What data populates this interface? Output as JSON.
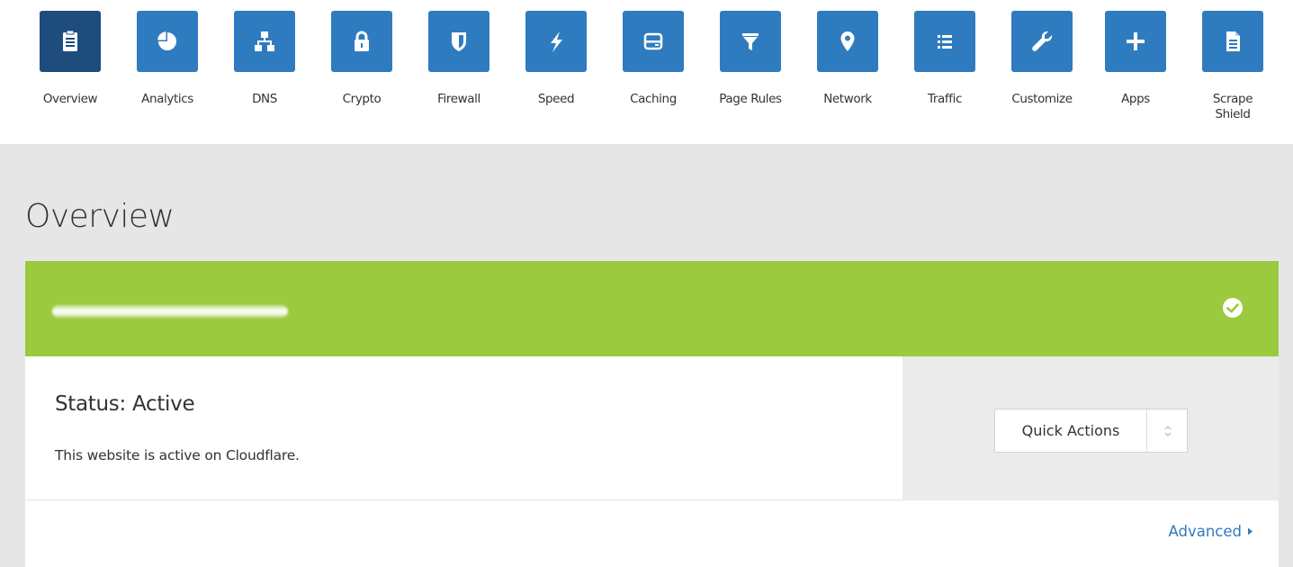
{
  "nav": {
    "items": [
      {
        "label": "Overview",
        "icon": "clipboard-icon",
        "active": true
      },
      {
        "label": "Analytics",
        "icon": "pie-chart-icon",
        "active": false
      },
      {
        "label": "DNS",
        "icon": "sitemap-icon",
        "active": false
      },
      {
        "label": "Crypto",
        "icon": "lock-icon",
        "active": false
      },
      {
        "label": "Firewall",
        "icon": "shield-icon",
        "active": false
      },
      {
        "label": "Speed",
        "icon": "lightning-icon",
        "active": false
      },
      {
        "label": "Caching",
        "icon": "server-icon",
        "active": false
      },
      {
        "label": "Page Rules",
        "icon": "filter-icon",
        "active": false
      },
      {
        "label": "Network",
        "icon": "location-pin-icon",
        "active": false
      },
      {
        "label": "Traffic",
        "icon": "list-icon",
        "active": false
      },
      {
        "label": "Customize",
        "icon": "wrench-icon",
        "active": false
      },
      {
        "label": "Apps",
        "icon": "plus-icon",
        "active": false
      },
      {
        "label": "Scrape\nShield",
        "icon": "document-icon",
        "active": false
      }
    ]
  },
  "page": {
    "title": "Overview"
  },
  "zone": {
    "name_redacted": true,
    "status_icon": "check-circle-icon",
    "status_title": "Status: Active",
    "status_description": "This website is active on Cloudflare.",
    "quick_actions_label": "Quick Actions",
    "advanced_label": "Advanced"
  },
  "colors": {
    "nav_tile": "#2f7bbf",
    "nav_tile_active": "#1d4c7d",
    "banner_green": "#9bca3e",
    "link_blue": "#2f7bbf",
    "background_gray": "#e6e6e6"
  }
}
